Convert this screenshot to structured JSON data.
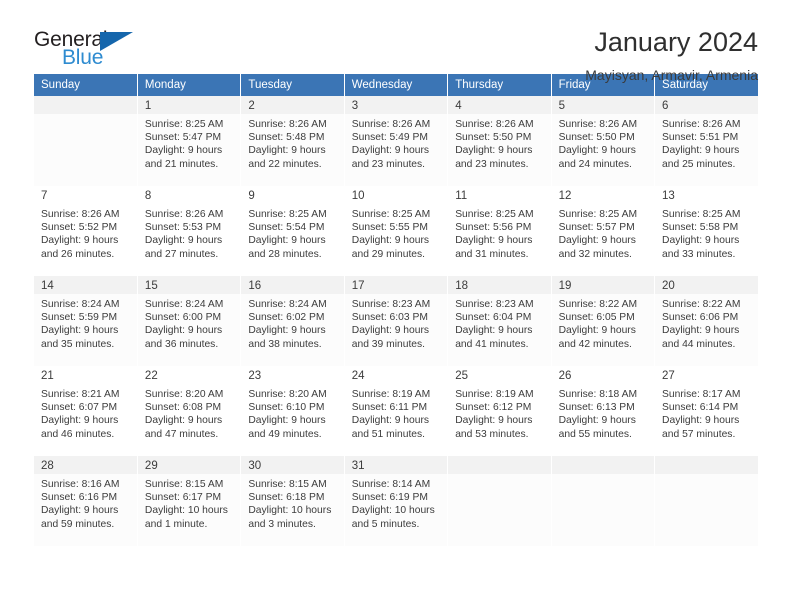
{
  "brand": {
    "name_part1": "General",
    "name_part2": "Blue",
    "mark": "triangle-logo-icon"
  },
  "header": {
    "title": "January 2024",
    "subtitle": "Mayisyan, Armavir, Armenia"
  },
  "colors": {
    "header_blue": "#3b75b5",
    "logo_blue": "#2e8bd0",
    "logo_mark_blue": "#1566ac",
    "row_stripe": "#f2f2f2",
    "text": "#3c3c3c"
  },
  "weekday_headers": [
    "Sunday",
    "Monday",
    "Tuesday",
    "Wednesday",
    "Thursday",
    "Friday",
    "Saturday"
  ],
  "weeks": [
    [
      {
        "day": "",
        "sunrise": "",
        "sunset": "",
        "daylight_line1": "",
        "daylight_line2": ""
      },
      {
        "day": "1",
        "sunrise": "Sunrise: 8:25 AM",
        "sunset": "Sunset: 5:47 PM",
        "daylight_line1": "Daylight: 9 hours",
        "daylight_line2": "and 21 minutes."
      },
      {
        "day": "2",
        "sunrise": "Sunrise: 8:26 AM",
        "sunset": "Sunset: 5:48 PM",
        "daylight_line1": "Daylight: 9 hours",
        "daylight_line2": "and 22 minutes."
      },
      {
        "day": "3",
        "sunrise": "Sunrise: 8:26 AM",
        "sunset": "Sunset: 5:49 PM",
        "daylight_line1": "Daylight: 9 hours",
        "daylight_line2": "and 23 minutes."
      },
      {
        "day": "4",
        "sunrise": "Sunrise: 8:26 AM",
        "sunset": "Sunset: 5:50 PM",
        "daylight_line1": "Daylight: 9 hours",
        "daylight_line2": "and 23 minutes."
      },
      {
        "day": "5",
        "sunrise": "Sunrise: 8:26 AM",
        "sunset": "Sunset: 5:50 PM",
        "daylight_line1": "Daylight: 9 hours",
        "daylight_line2": "and 24 minutes."
      },
      {
        "day": "6",
        "sunrise": "Sunrise: 8:26 AM",
        "sunset": "Sunset: 5:51 PM",
        "daylight_line1": "Daylight: 9 hours",
        "daylight_line2": "and 25 minutes."
      }
    ],
    [
      {
        "day": "7",
        "sunrise": "Sunrise: 8:26 AM",
        "sunset": "Sunset: 5:52 PM",
        "daylight_line1": "Daylight: 9 hours",
        "daylight_line2": "and 26 minutes."
      },
      {
        "day": "8",
        "sunrise": "Sunrise: 8:26 AM",
        "sunset": "Sunset: 5:53 PM",
        "daylight_line1": "Daylight: 9 hours",
        "daylight_line2": "and 27 minutes."
      },
      {
        "day": "9",
        "sunrise": "Sunrise: 8:25 AM",
        "sunset": "Sunset: 5:54 PM",
        "daylight_line1": "Daylight: 9 hours",
        "daylight_line2": "and 28 minutes."
      },
      {
        "day": "10",
        "sunrise": "Sunrise: 8:25 AM",
        "sunset": "Sunset: 5:55 PM",
        "daylight_line1": "Daylight: 9 hours",
        "daylight_line2": "and 29 minutes."
      },
      {
        "day": "11",
        "sunrise": "Sunrise: 8:25 AM",
        "sunset": "Sunset: 5:56 PM",
        "daylight_line1": "Daylight: 9 hours",
        "daylight_line2": "and 31 minutes."
      },
      {
        "day": "12",
        "sunrise": "Sunrise: 8:25 AM",
        "sunset": "Sunset: 5:57 PM",
        "daylight_line1": "Daylight: 9 hours",
        "daylight_line2": "and 32 minutes."
      },
      {
        "day": "13",
        "sunrise": "Sunrise: 8:25 AM",
        "sunset": "Sunset: 5:58 PM",
        "daylight_line1": "Daylight: 9 hours",
        "daylight_line2": "and 33 minutes."
      }
    ],
    [
      {
        "day": "14",
        "sunrise": "Sunrise: 8:24 AM",
        "sunset": "Sunset: 5:59 PM",
        "daylight_line1": "Daylight: 9 hours",
        "daylight_line2": "and 35 minutes."
      },
      {
        "day": "15",
        "sunrise": "Sunrise: 8:24 AM",
        "sunset": "Sunset: 6:00 PM",
        "daylight_line1": "Daylight: 9 hours",
        "daylight_line2": "and 36 minutes."
      },
      {
        "day": "16",
        "sunrise": "Sunrise: 8:24 AM",
        "sunset": "Sunset: 6:02 PM",
        "daylight_line1": "Daylight: 9 hours",
        "daylight_line2": "and 38 minutes."
      },
      {
        "day": "17",
        "sunrise": "Sunrise: 8:23 AM",
        "sunset": "Sunset: 6:03 PM",
        "daylight_line1": "Daylight: 9 hours",
        "daylight_line2": "and 39 minutes."
      },
      {
        "day": "18",
        "sunrise": "Sunrise: 8:23 AM",
        "sunset": "Sunset: 6:04 PM",
        "daylight_line1": "Daylight: 9 hours",
        "daylight_line2": "and 41 minutes."
      },
      {
        "day": "19",
        "sunrise": "Sunrise: 8:22 AM",
        "sunset": "Sunset: 6:05 PM",
        "daylight_line1": "Daylight: 9 hours",
        "daylight_line2": "and 42 minutes."
      },
      {
        "day": "20",
        "sunrise": "Sunrise: 8:22 AM",
        "sunset": "Sunset: 6:06 PM",
        "daylight_line1": "Daylight: 9 hours",
        "daylight_line2": "and 44 minutes."
      }
    ],
    [
      {
        "day": "21",
        "sunrise": "Sunrise: 8:21 AM",
        "sunset": "Sunset: 6:07 PM",
        "daylight_line1": "Daylight: 9 hours",
        "daylight_line2": "and 46 minutes."
      },
      {
        "day": "22",
        "sunrise": "Sunrise: 8:20 AM",
        "sunset": "Sunset: 6:08 PM",
        "daylight_line1": "Daylight: 9 hours",
        "daylight_line2": "and 47 minutes."
      },
      {
        "day": "23",
        "sunrise": "Sunrise: 8:20 AM",
        "sunset": "Sunset: 6:10 PM",
        "daylight_line1": "Daylight: 9 hours",
        "daylight_line2": "and 49 minutes."
      },
      {
        "day": "24",
        "sunrise": "Sunrise: 8:19 AM",
        "sunset": "Sunset: 6:11 PM",
        "daylight_line1": "Daylight: 9 hours",
        "daylight_line2": "and 51 minutes."
      },
      {
        "day": "25",
        "sunrise": "Sunrise: 8:19 AM",
        "sunset": "Sunset: 6:12 PM",
        "daylight_line1": "Daylight: 9 hours",
        "daylight_line2": "and 53 minutes."
      },
      {
        "day": "26",
        "sunrise": "Sunrise: 8:18 AM",
        "sunset": "Sunset: 6:13 PM",
        "daylight_line1": "Daylight: 9 hours",
        "daylight_line2": "and 55 minutes."
      },
      {
        "day": "27",
        "sunrise": "Sunrise: 8:17 AM",
        "sunset": "Sunset: 6:14 PM",
        "daylight_line1": "Daylight: 9 hours",
        "daylight_line2": "and 57 minutes."
      }
    ],
    [
      {
        "day": "28",
        "sunrise": "Sunrise: 8:16 AM",
        "sunset": "Sunset: 6:16 PM",
        "daylight_line1": "Daylight: 9 hours",
        "daylight_line2": "and 59 minutes."
      },
      {
        "day": "29",
        "sunrise": "Sunrise: 8:15 AM",
        "sunset": "Sunset: 6:17 PM",
        "daylight_line1": "Daylight: 10 hours",
        "daylight_line2": "and 1 minute."
      },
      {
        "day": "30",
        "sunrise": "Sunrise: 8:15 AM",
        "sunset": "Sunset: 6:18 PM",
        "daylight_line1": "Daylight: 10 hours",
        "daylight_line2": "and 3 minutes."
      },
      {
        "day": "31",
        "sunrise": "Sunrise: 8:14 AM",
        "sunset": "Sunset: 6:19 PM",
        "daylight_line1": "Daylight: 10 hours",
        "daylight_line2": "and 5 minutes."
      },
      {
        "day": "",
        "sunrise": "",
        "sunset": "",
        "daylight_line1": "",
        "daylight_line2": ""
      },
      {
        "day": "",
        "sunrise": "",
        "sunset": "",
        "daylight_line1": "",
        "daylight_line2": ""
      },
      {
        "day": "",
        "sunrise": "",
        "sunset": "",
        "daylight_line1": "",
        "daylight_line2": ""
      }
    ]
  ]
}
